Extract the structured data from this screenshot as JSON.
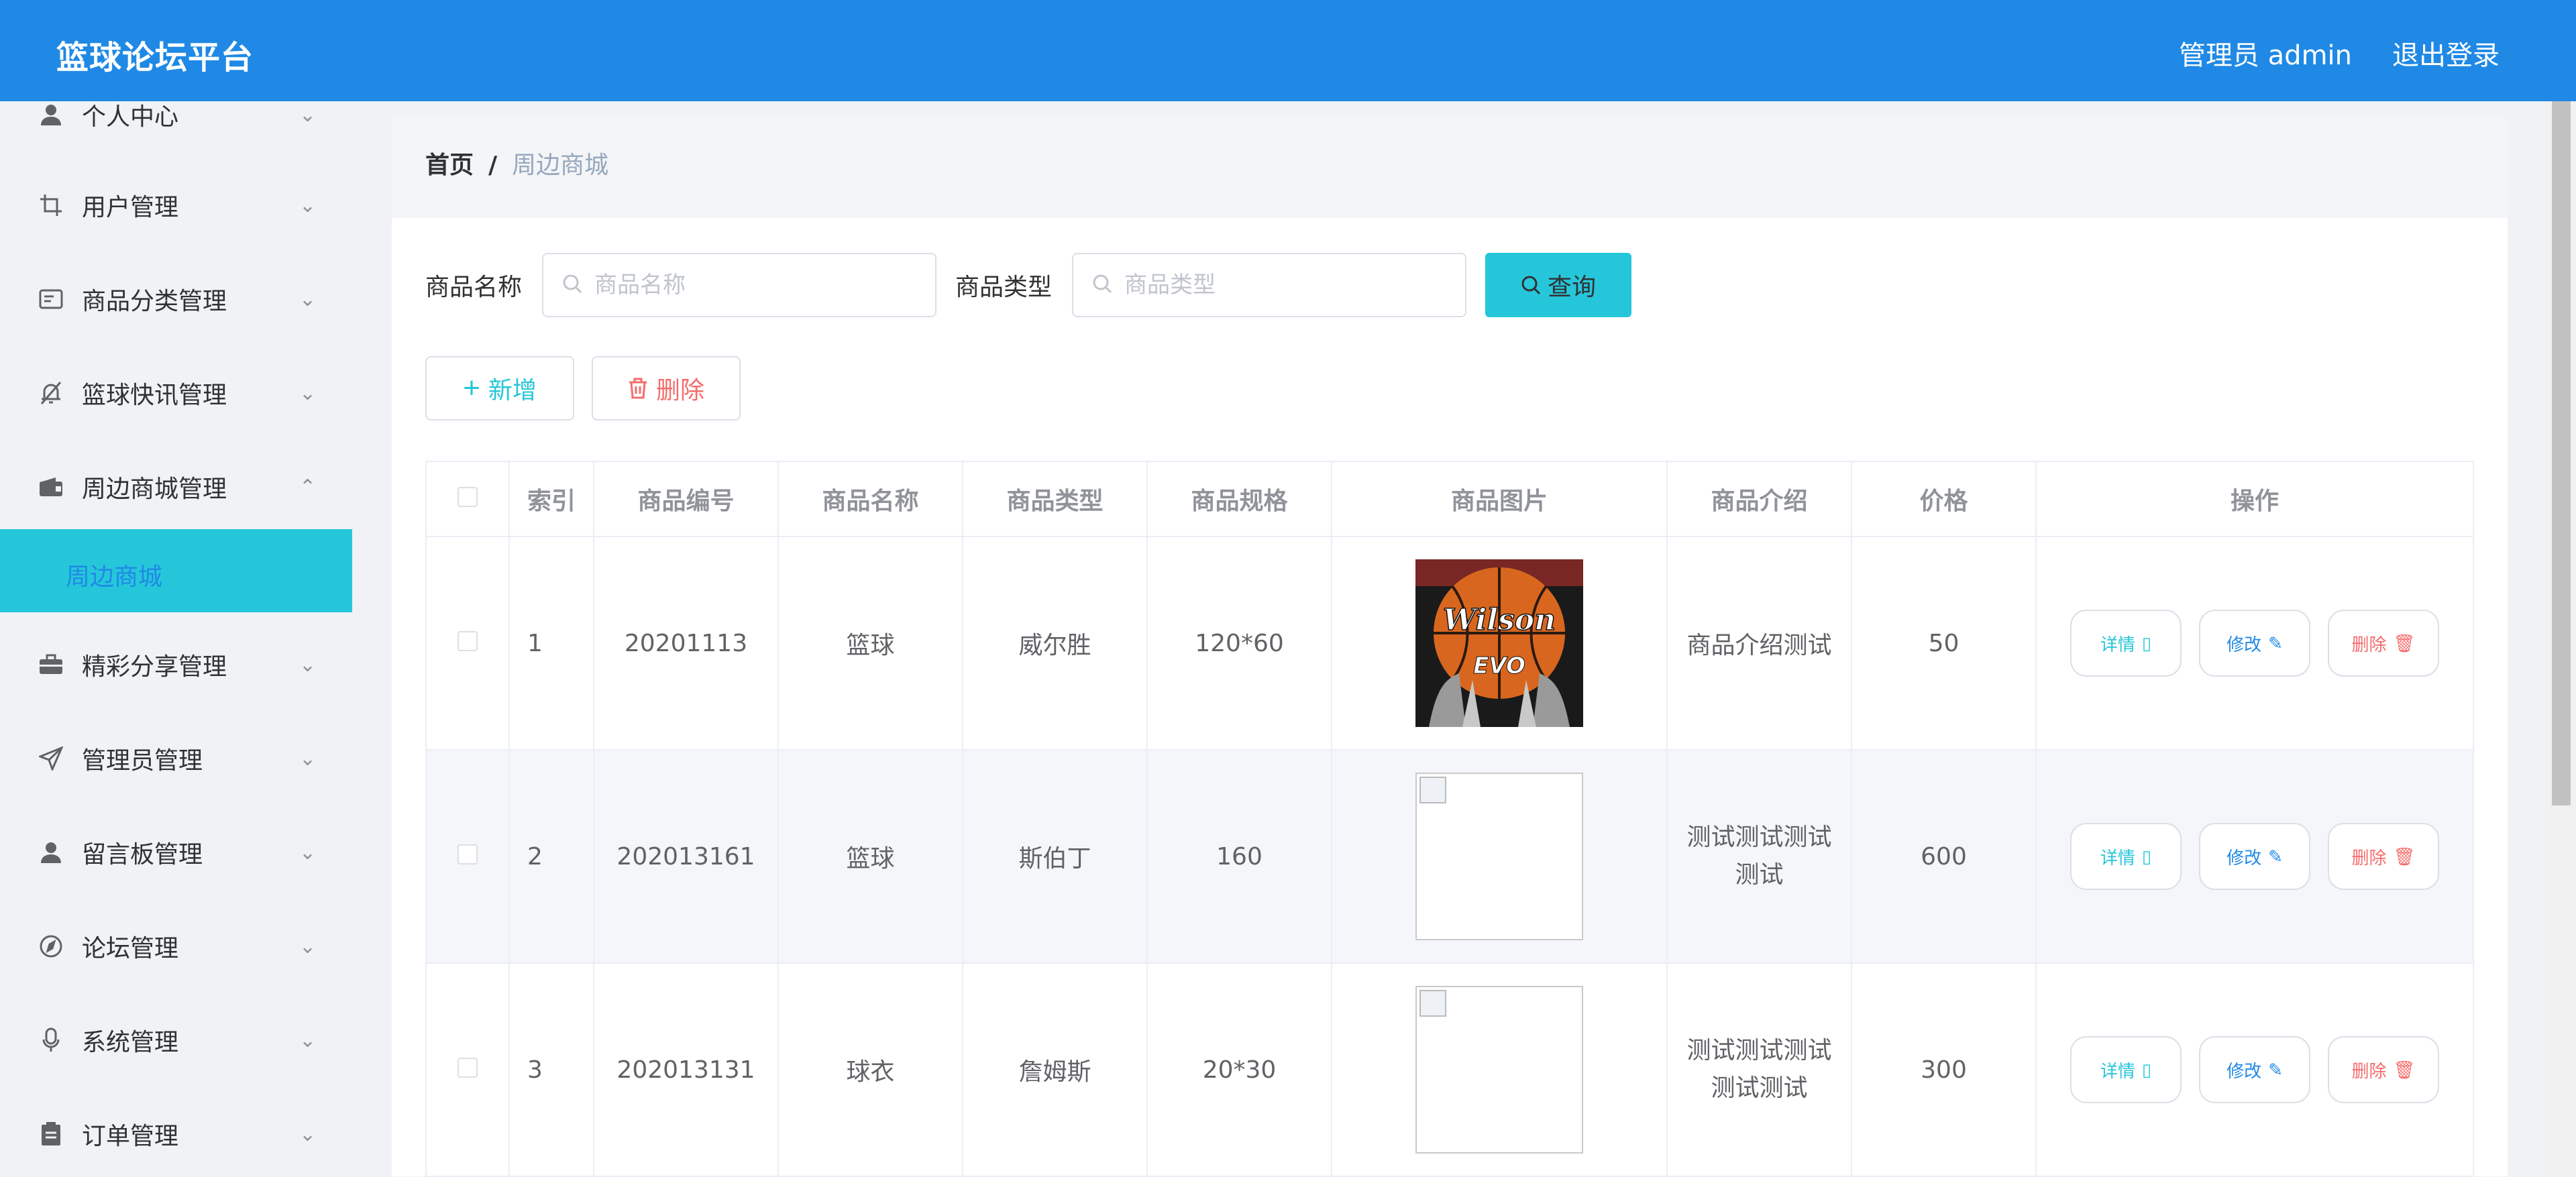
{
  "header": {
    "title": "篮球论坛平台",
    "user": "管理员 admin",
    "logout": "退出登录"
  },
  "sidebar": {
    "items": [
      {
        "label": "个人中心",
        "icon": "user-icon"
      },
      {
        "label": "用户管理",
        "icon": "crop-icon"
      },
      {
        "label": "商品分类管理",
        "icon": "card-icon"
      },
      {
        "label": "篮球快讯管理",
        "icon": "bell-off-icon"
      },
      {
        "label": "周边商城管理",
        "icon": "wallet-icon"
      },
      {
        "label": "精彩分享管理",
        "icon": "suitcase-icon"
      },
      {
        "label": "管理员管理",
        "icon": "send-icon"
      },
      {
        "label": "留言板管理",
        "icon": "user-solid-icon"
      },
      {
        "label": "论坛管理",
        "icon": "compass-icon"
      },
      {
        "label": "系统管理",
        "icon": "mic-icon"
      },
      {
        "label": "订单管理",
        "icon": "clipboard-icon"
      }
    ],
    "active_sub": "周边商城"
  },
  "breadcrumb": {
    "home": "首页",
    "separator": "/",
    "current": "周边商城"
  },
  "search": {
    "name_label": "商品名称",
    "name_placeholder": "商品名称",
    "type_label": "商品类型",
    "type_placeholder": "商品类型",
    "query_button": "查询"
  },
  "actions": {
    "add": "新增",
    "delete": "删除"
  },
  "table": {
    "headers": [
      "索引",
      "商品编号",
      "商品名称",
      "商品类型",
      "商品规格",
      "商品图片",
      "商品介绍",
      "价格",
      "操作"
    ],
    "rows": [
      {
        "index": "1",
        "code": "20201113",
        "name": "篮球",
        "type": "威尔胜",
        "spec": "120*60",
        "intro": "商品介绍测试",
        "price": "50",
        "image": "wilson-basketball"
      },
      {
        "index": "2",
        "code": "202013161",
        "name": "篮球",
        "type": "斯伯丁",
        "spec": "160",
        "intro": "测试测试测试测试",
        "price": "600",
        "image": "broken"
      },
      {
        "index": "3",
        "code": "202013131",
        "name": "球衣",
        "type": "詹姆斯",
        "spec": "20*30",
        "intro": "测试测试测试测试测试",
        "price": "300",
        "image": "broken"
      }
    ],
    "row_buttons": {
      "detail": "详情",
      "edit": "修改",
      "delete": "删除"
    }
  },
  "image_text": {
    "brand": "Wilson",
    "model": "EVO"
  },
  "colors": {
    "header_bg": "#1f89e5",
    "accent": "#26c6da",
    "danger": "#f56c6c",
    "primary": "#1f89e5"
  }
}
